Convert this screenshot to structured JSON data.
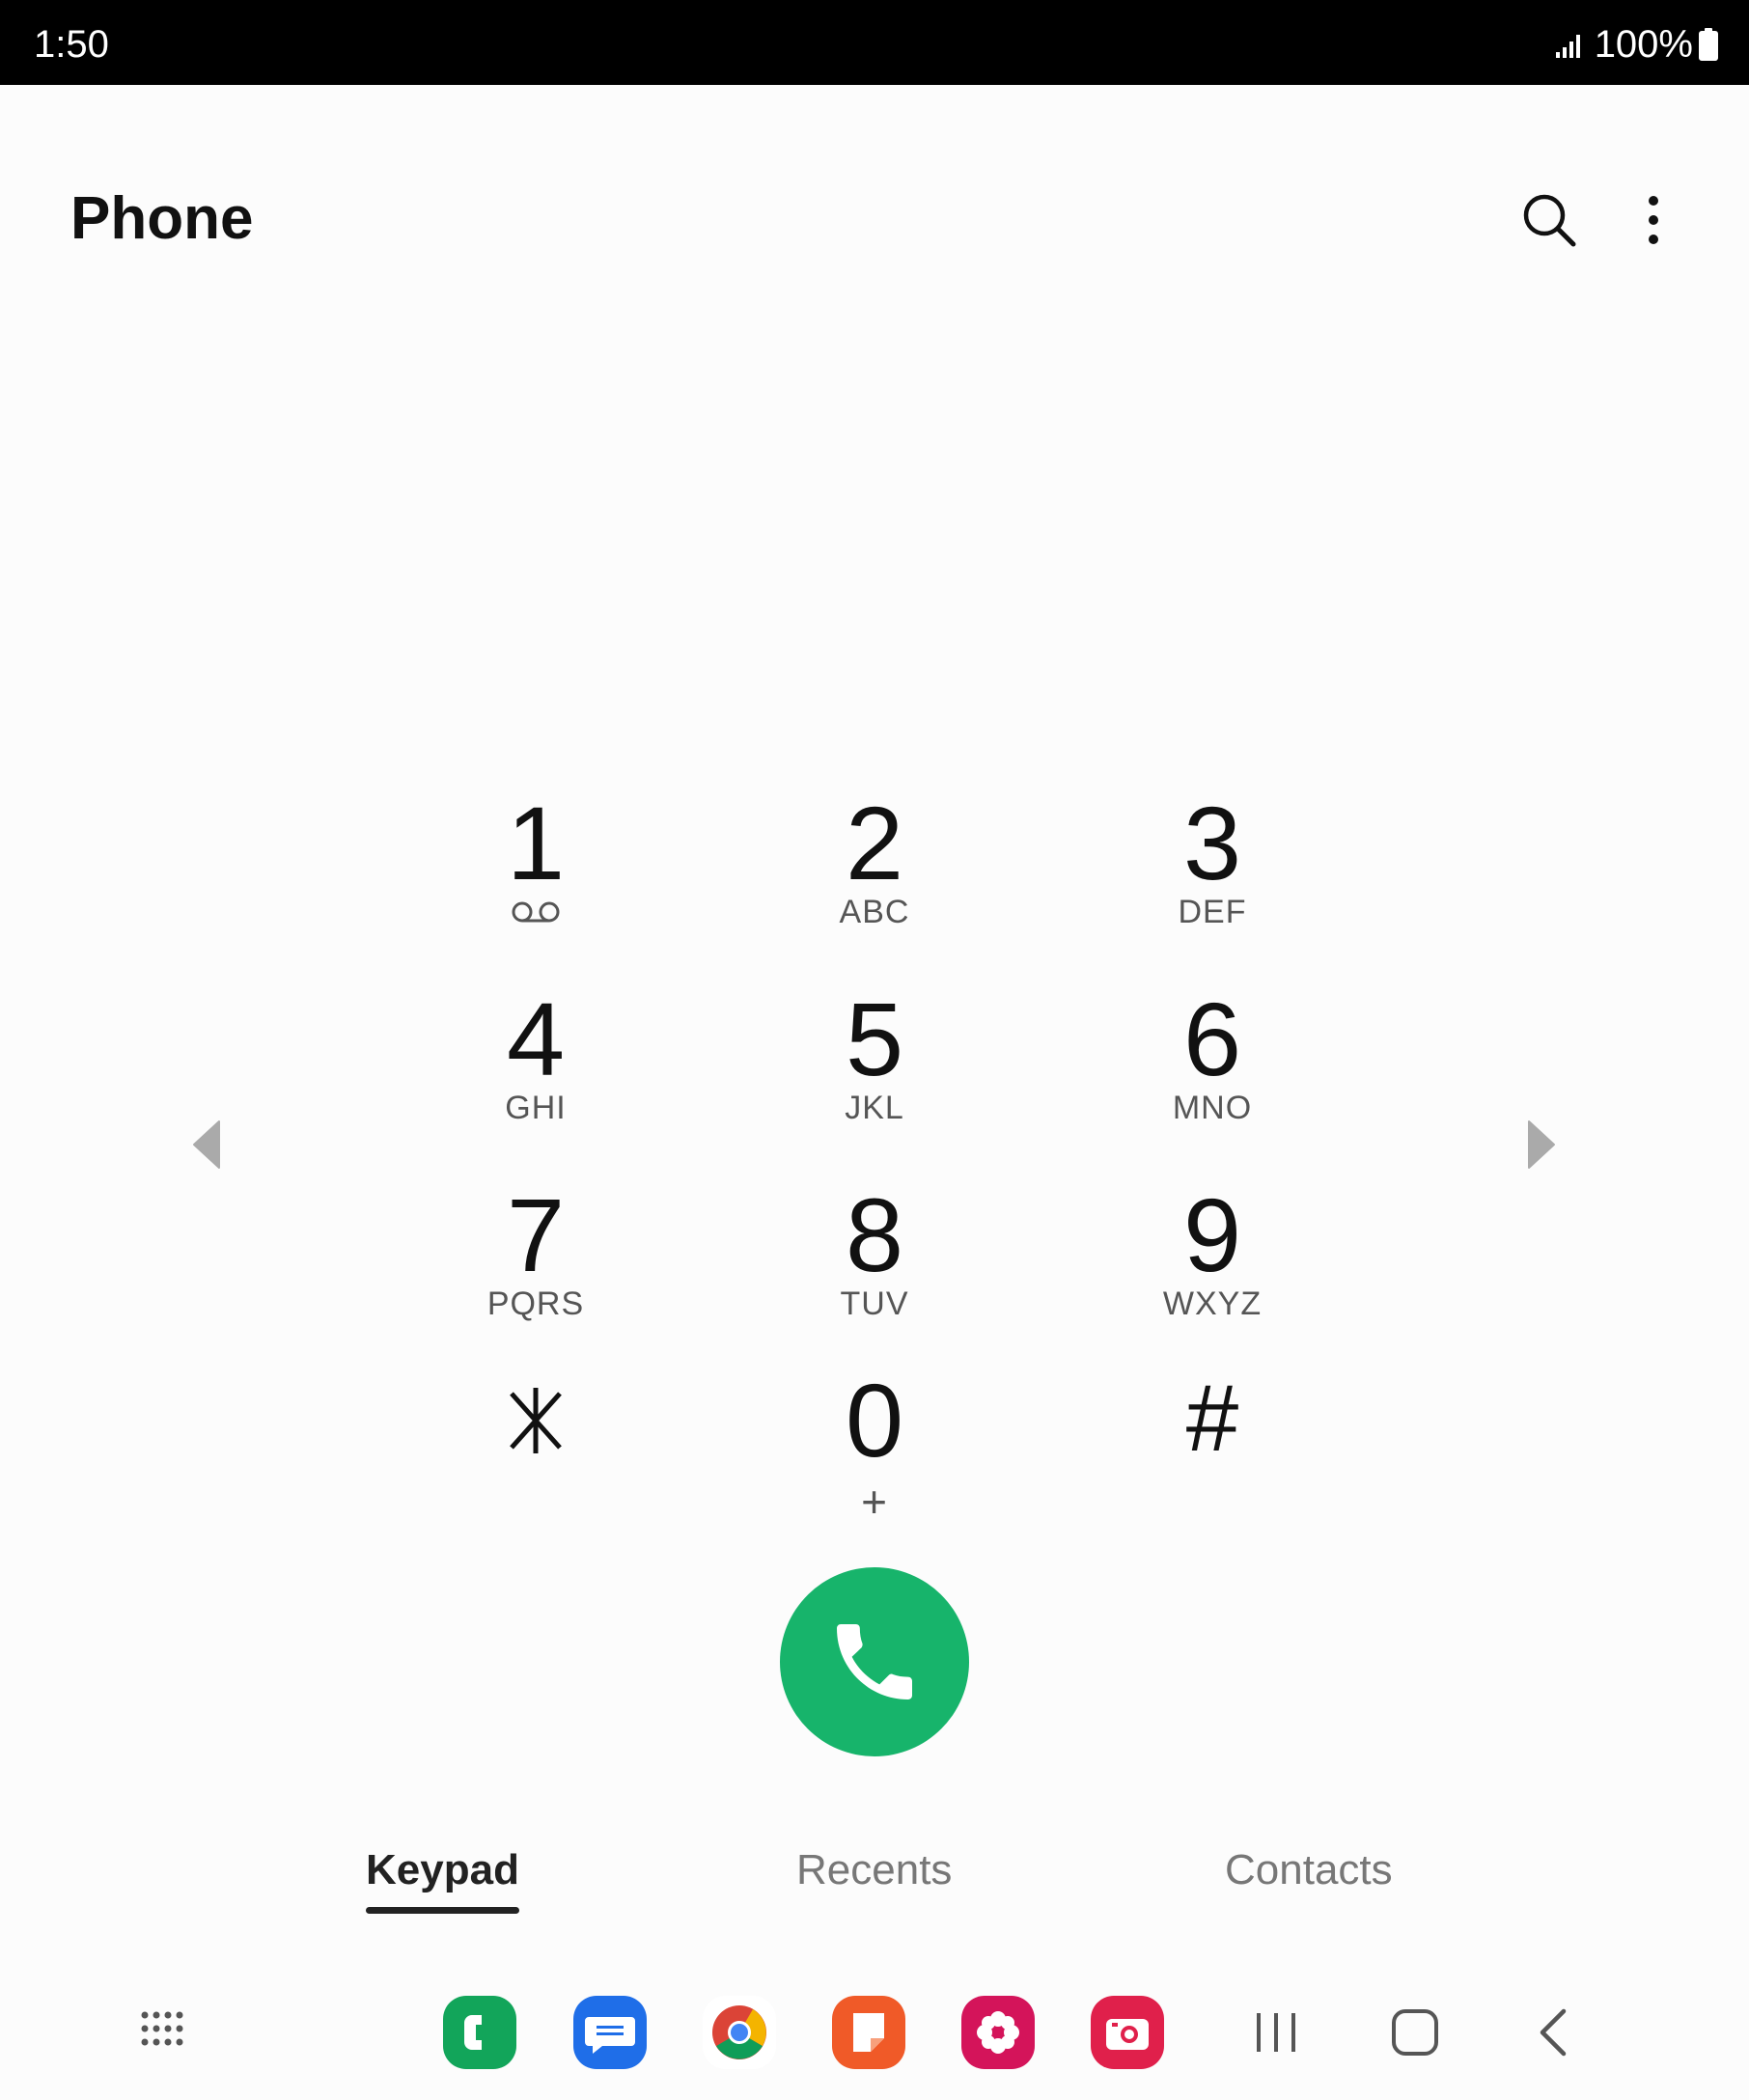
{
  "status_bar": {
    "time": "1:50",
    "battery": "100%",
    "icons": [
      "signal-icon",
      "battery-icon"
    ]
  },
  "header": {
    "title": "Phone",
    "icons": [
      "search-icon",
      "more-options-icon"
    ]
  },
  "dialpad": {
    "keys": [
      {
        "digit": "1",
        "letters": "",
        "icon": "voicemail-icon"
      },
      {
        "digit": "2",
        "letters": "ABC"
      },
      {
        "digit": "3",
        "letters": "DEF"
      },
      {
        "digit": "4",
        "letters": "GHI"
      },
      {
        "digit": "5",
        "letters": "JKL"
      },
      {
        "digit": "6",
        "letters": "MNO"
      },
      {
        "digit": "7",
        "letters": "PQRS"
      },
      {
        "digit": "8",
        "letters": "TUV"
      },
      {
        "digit": "9",
        "letters": "WXYZ"
      },
      {
        "digit": "",
        "letters": "",
        "icon": "asterisk-icon"
      },
      {
        "digit": "0",
        "letters": "+"
      },
      {
        "digit": "#",
        "letters": ""
      }
    ],
    "call_button_icon": "phone-handset-icon",
    "call_color": "#17b46b"
  },
  "tabs": [
    {
      "label": "Keypad",
      "active": true
    },
    {
      "label": "Recents",
      "active": false
    },
    {
      "label": "Contacts",
      "active": false
    }
  ],
  "navbar": {
    "dock_apps": [
      {
        "name": "phone-app-icon",
        "color": "#12a55a"
      },
      {
        "name": "messages-app-icon",
        "color": "#1f6ee8"
      },
      {
        "name": "chrome-app-icon",
        "color": "#ffffff"
      },
      {
        "name": "notes-app-icon",
        "color": "#f05a28"
      },
      {
        "name": "flower-app-icon",
        "color": "#d4145a"
      },
      {
        "name": "camera-app-icon",
        "color": "#e0204b"
      }
    ],
    "buttons": [
      "recent-apps-icon",
      "home-icon",
      "back-icon"
    ]
  }
}
